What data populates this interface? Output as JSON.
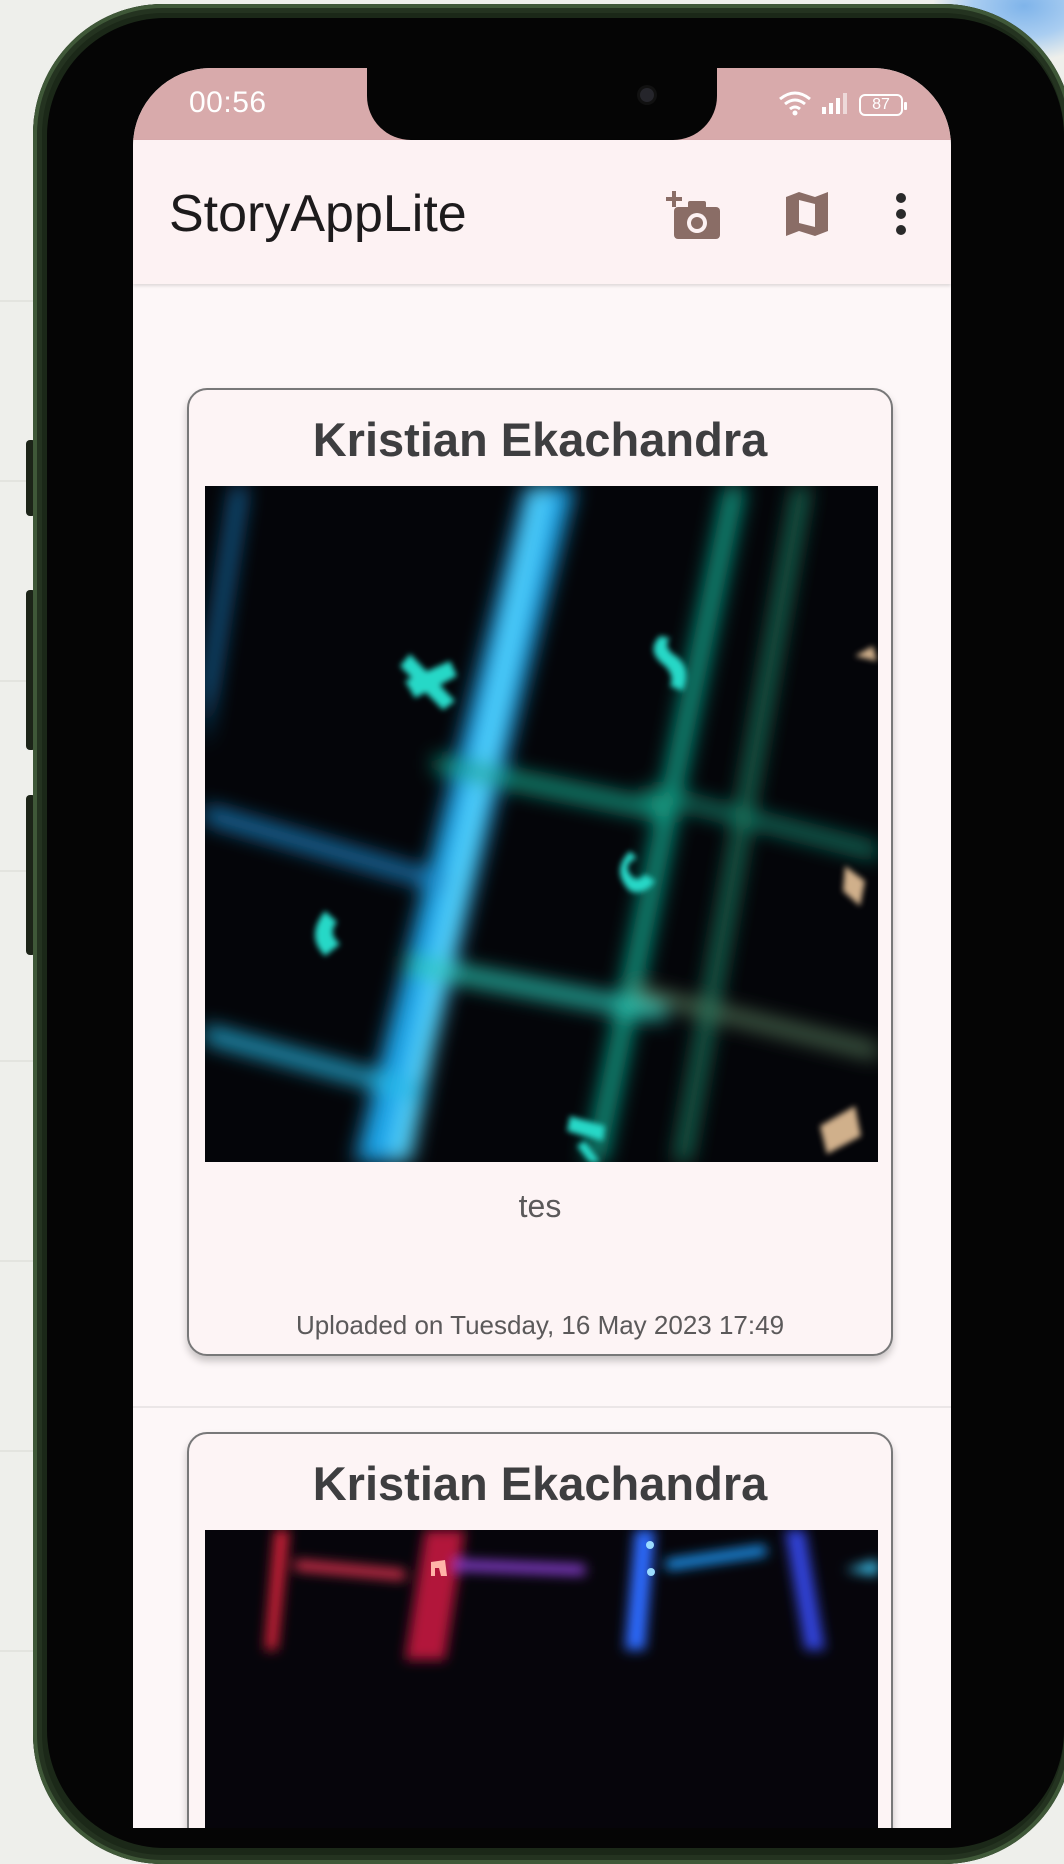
{
  "status_bar": {
    "time": "00:56",
    "battery": "87",
    "wifi_icon": "wifi-icon",
    "signal_icon": "signal-icon"
  },
  "app_bar": {
    "title": "StoryAppLite",
    "actions": [
      {
        "icon": "add-photo-icon"
      },
      {
        "icon": "map-icon"
      },
      {
        "icon": "more-vert-icon"
      }
    ]
  },
  "stories": [
    {
      "name": "Kristian Ekachandra",
      "description": "tes",
      "uploaded": "Uploaded on Tuesday, 16 May 2023 17:49",
      "photo": "cyan-backlit-keyboard-photo"
    },
    {
      "name": "Kristian Ekachandra",
      "photo": "rgb-backlit-keyboard-photo"
    }
  ],
  "colors": {
    "status_bar": "#d8aaab",
    "app_bar": "#fdf2f3",
    "card_background": "#fdf4f5",
    "icon_tint": "#8a6d66",
    "phone_frame": "#1b2818"
  }
}
